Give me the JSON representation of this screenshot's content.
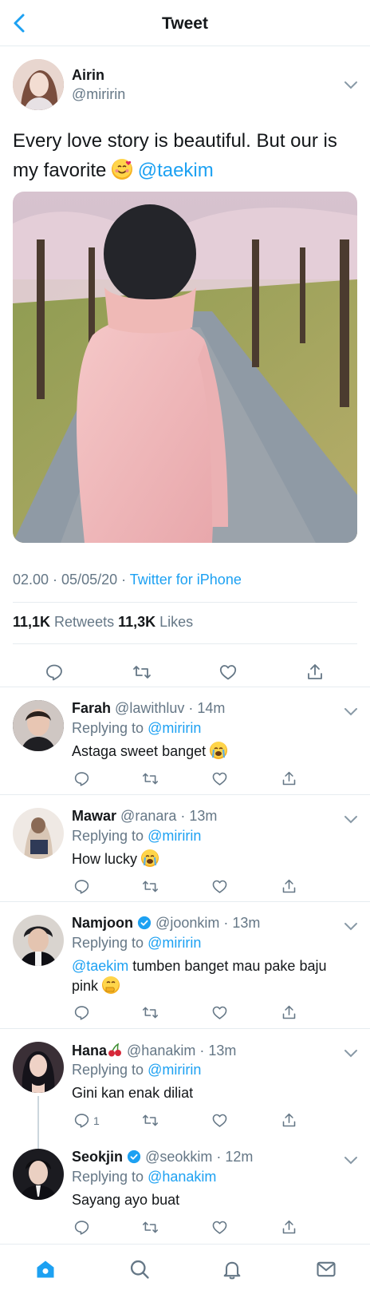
{
  "header": {
    "title": "Tweet"
  },
  "main_tweet": {
    "name": "Airin",
    "handle": "@miririn",
    "text_before": "Every love story is beautiful. But our is my favorite ",
    "emoji": "smiling-face-with-hearts",
    "mention": "@taekim",
    "time": "02.00 · 05/05/20 · ",
    "source": "Twitter for iPhone",
    "retweets_count": "11,1K",
    "retweets_label": " Retweets  ",
    "likes_count": "11,3K",
    "likes_label": " Likes"
  },
  "replies": [
    {
      "name": "Farah",
      "handle": "@lawithluv",
      "time": "14m",
      "replying_label": "Replying to ",
      "replying_to": "@miririn",
      "text": "Astaga sweet banget ",
      "emoji": "loudly-crying-face"
    },
    {
      "name": "Mawar",
      "handle": "@ranara",
      "time": "13m",
      "replying_label": "Replying to ",
      "replying_to": "@miririn",
      "text": "How lucky ",
      "emoji": "loudly-crying-face"
    },
    {
      "name": "Namjoon",
      "handle": "@joonkim",
      "time": "13m",
      "verified": true,
      "replying_label": "Replying to ",
      "replying_to": "@miririn",
      "mention": "@taekim",
      "text": " tumben banget mau pake baju pink ",
      "emoji": "face-with-hand-over-mouth"
    },
    {
      "name": "Hana",
      "name_emoji": "cherries",
      "handle": "@hanakim",
      "time": "13m",
      "replying_label": "Replying to ",
      "replying_to": "@miririn",
      "text": "Gini kan enak diliat",
      "reply_count": "1"
    },
    {
      "name": "Seokjin",
      "handle": "@seokkim",
      "time": "12m",
      "verified": true,
      "replying_label": "Replying to ",
      "replying_to": "@hanakim",
      "text": "Sayang ayo buat"
    }
  ],
  "icons": {
    "back": "chevron-left-icon",
    "more": "chevron-down-icon",
    "reply": "reply-icon",
    "retweet": "retweet-icon",
    "like": "heart-icon",
    "share": "share-icon",
    "home": "home-icon",
    "search": "search-icon",
    "notifications": "bell-icon",
    "messages": "mail-icon"
  },
  "colors": {
    "accent": "#1da1f2",
    "text": "#14171a",
    "secondary": "#657786",
    "divider": "#e6ecf0"
  }
}
